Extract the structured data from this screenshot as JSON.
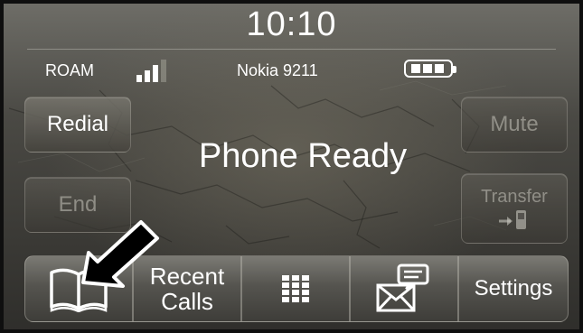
{
  "status_bar": {
    "time": "10:10",
    "roam": "ROAM",
    "device": "Nokia 9211",
    "signal_bars": 3,
    "signal_max": 4,
    "battery_segments": 3
  },
  "main": {
    "status": "Phone Ready"
  },
  "side_buttons": {
    "redial": "Redial",
    "end": "End",
    "mute": "Mute",
    "transfer": "Transfer"
  },
  "bottom_bar": {
    "recent_line1": "Recent",
    "recent_line2": "Calls",
    "settings": "Settings"
  },
  "colors": {
    "text": "#ffffff",
    "dim_text": "#c8c6be",
    "arrow": "#000000"
  },
  "icons": [
    "phonebook-icon",
    "keypad-icon",
    "messages-icon",
    "transfer-icon",
    "signal-icon",
    "battery-icon",
    "pointer-arrow"
  ]
}
